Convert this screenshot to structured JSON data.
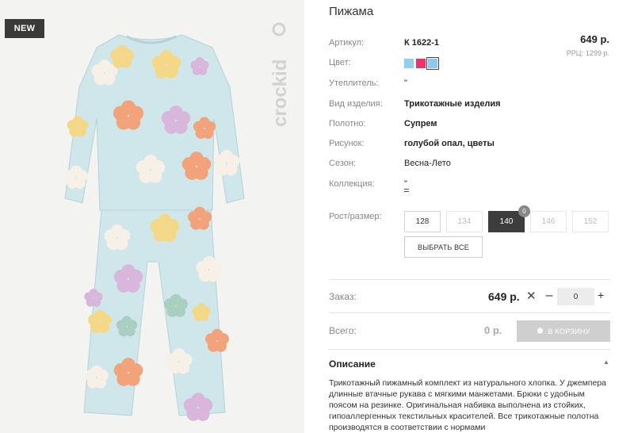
{
  "badge": "NEW",
  "product": {
    "title": "Пижама",
    "price": "649 р.",
    "rrp_label": "РРЦ:",
    "rrp_value": "1299 р."
  },
  "attributes": [
    {
      "label": "Артикул:",
      "value": "К 1622-1"
    },
    {
      "label": "Цвет:",
      "value": ""
    },
    {
      "label": "Утеплитель:",
      "value": "\""
    },
    {
      "label": "Вид изделия:",
      "value": "Трикотажные изделия"
    },
    {
      "label": "Полотно:",
      "value": "Супрем"
    },
    {
      "label": "Рисунок:",
      "value": "голубой опал, цветы"
    },
    {
      "label": "Сезон:",
      "value": "Весна-Лето"
    },
    {
      "label": "Коллекция:",
      "value": "\""
    }
  ],
  "colors": {
    "swatches": [
      "#8fd0f0",
      "#e8336e",
      "#8fc8ec"
    ],
    "selected_index": 2
  },
  "sizes": {
    "label": "Рост/размер:",
    "options": [
      "128",
      "134",
      "140",
      "146",
      "152"
    ],
    "selected_count": "0",
    "select_all": "ВЫБРАТЬ ВСЕ"
  },
  "order": {
    "label": "Заказ:",
    "price": "649 р.",
    "multiply": "✕",
    "minus": "–",
    "quantity": "0",
    "plus": "+"
  },
  "total": {
    "label": "Всего:",
    "value": "0 р.",
    "cart_button": "В КОРЗИНУ"
  },
  "description": {
    "heading": "Описание",
    "text": "Трикотажный пижамный комплект из натурального хлопка. У джемпера длинные втачные рукава с мягкими манжетами. Брюки с удобным поясом на резинке. Оригинальная набивка выполнена из стойких, гипоаллергенных текстильных красителей. Все трикотажные полотна производятся в соответствии с нормами"
  },
  "brand": {
    "logo": "crockid"
  }
}
